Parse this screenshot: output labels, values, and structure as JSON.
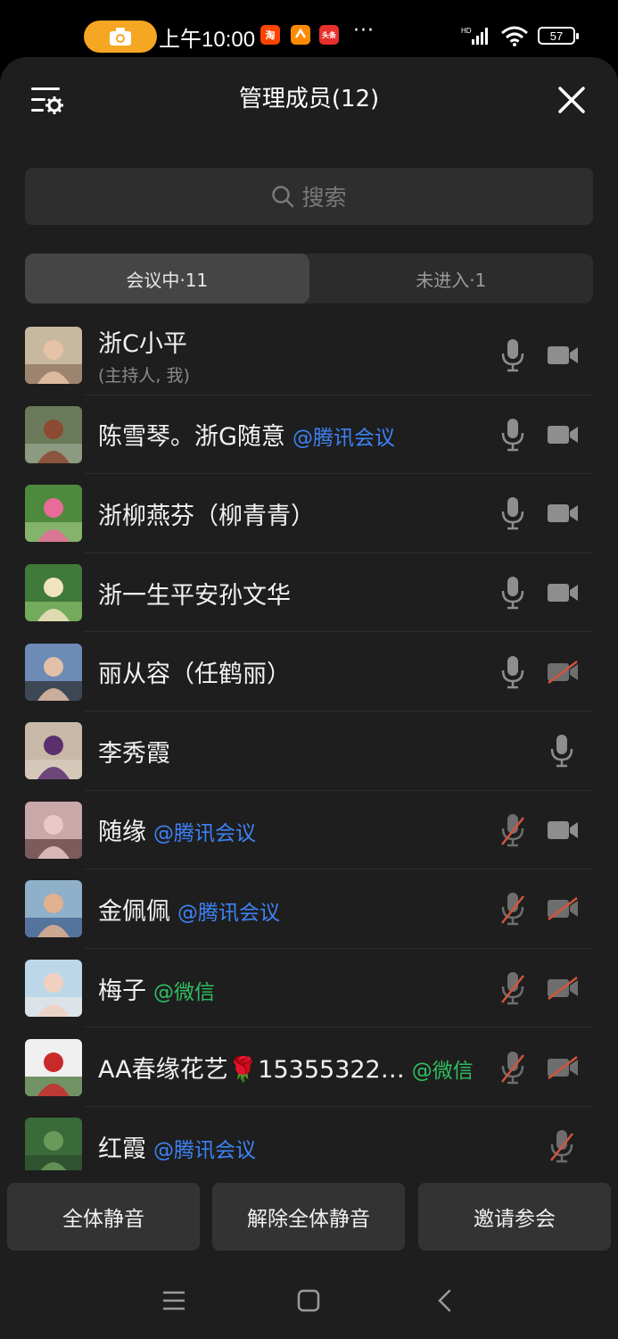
{
  "status_bar": {
    "time": "上午10:00",
    "battery": "57",
    "network": "HD",
    "dots": "···",
    "apps": [
      {
        "name": "taobao-icon",
        "text": "淘",
        "color": "#ff4400"
      },
      {
        "name": "pay-icon",
        "text": "",
        "color": "#ff8a00"
      },
      {
        "name": "toutiao-icon",
        "text": "头条",
        "color": "#e8302c"
      }
    ]
  },
  "header": {
    "title": "管理成员(12)"
  },
  "search": {
    "placeholder": "搜索"
  },
  "tabs": [
    {
      "label": "会议中·11",
      "active": true
    },
    {
      "label": "未进入·1",
      "active": false
    }
  ],
  "members": [
    {
      "name": "浙C小平",
      "subtitle": "(主持人, 我)",
      "tag": "",
      "tag_color": "",
      "mic": "on",
      "cam": "on"
    },
    {
      "name": "陈雪琴。浙G随意",
      "subtitle": "",
      "tag": "@腾讯会议",
      "tag_color": "blue",
      "mic": "on",
      "cam": "on"
    },
    {
      "name": "浙柳燕芬（柳青青）",
      "subtitle": "",
      "tag": "",
      "tag_color": "",
      "mic": "on",
      "cam": "on"
    },
    {
      "name": "浙一生平安孙文华",
      "subtitle": "",
      "tag": "",
      "tag_color": "",
      "mic": "on",
      "cam": "on"
    },
    {
      "name": "丽从容（任鹤丽）",
      "subtitle": "",
      "tag": "",
      "tag_color": "",
      "mic": "on",
      "cam": "off"
    },
    {
      "name": "李秀霞",
      "subtitle": "",
      "tag": "",
      "tag_color": "",
      "mic": "on",
      "cam": "none"
    },
    {
      "name": "随缘",
      "subtitle": "",
      "tag": "@腾讯会议",
      "tag_color": "blue",
      "mic": "off",
      "cam": "on"
    },
    {
      "name": "金佩佩",
      "subtitle": "",
      "tag": "@腾讯会议",
      "tag_color": "blue",
      "mic": "off",
      "cam": "off"
    },
    {
      "name": "梅子",
      "subtitle": "",
      "tag": "@微信",
      "tag_color": "green",
      "mic": "off",
      "cam": "off"
    },
    {
      "name": "AA春缘花艺🌹15355322…",
      "subtitle": "",
      "tag": "@微信",
      "tag_color": "green",
      "mic": "off",
      "cam": "off"
    },
    {
      "name": "红霞",
      "subtitle": "",
      "tag": "@腾讯会议",
      "tag_color": "blue",
      "mic": "off",
      "cam": "none"
    }
  ],
  "avatars": [
    [
      "#c9b8a0",
      "#e6c3a6",
      "#8a6d58"
    ],
    [
      "#6b7a5a",
      "#8c4a32",
      "#9aa88f"
    ],
    [
      "#4e8a3e",
      "#e86b9a",
      "#9bc47f"
    ],
    [
      "#3f7a3a",
      "#f2e3c0",
      "#8cbf6a"
    ],
    [
      "#6d8bb5",
      "#e3c0a8",
      "#2b2b2b"
    ],
    [
      "#c8b8a8",
      "#5b2f6e",
      "#d9d0c0"
    ],
    [
      "#c8a8a8",
      "#e8c8c8",
      "#5a3a3a"
    ],
    [
      "#8fb0c8",
      "#e0b090",
      "#3a5a8a"
    ],
    [
      "#bcd8e8",
      "#f0d0c0",
      "#e8e8e8"
    ],
    [
      "#f0f0f0",
      "#c82a2a",
      "#3a6a2a"
    ],
    [
      "#3a6a3a",
      "#6a9a5a",
      "#2a4a2a"
    ]
  ],
  "actions": {
    "mute_all": "全体静音",
    "unmute_all": "解除全体静音",
    "invite": "邀请参会"
  },
  "colors": {
    "panel_bg": "#1e1e1e",
    "muted_slash": "#d4543c",
    "link_blue": "#3d82f6",
    "wechat_green": "#2fbf5f"
  }
}
